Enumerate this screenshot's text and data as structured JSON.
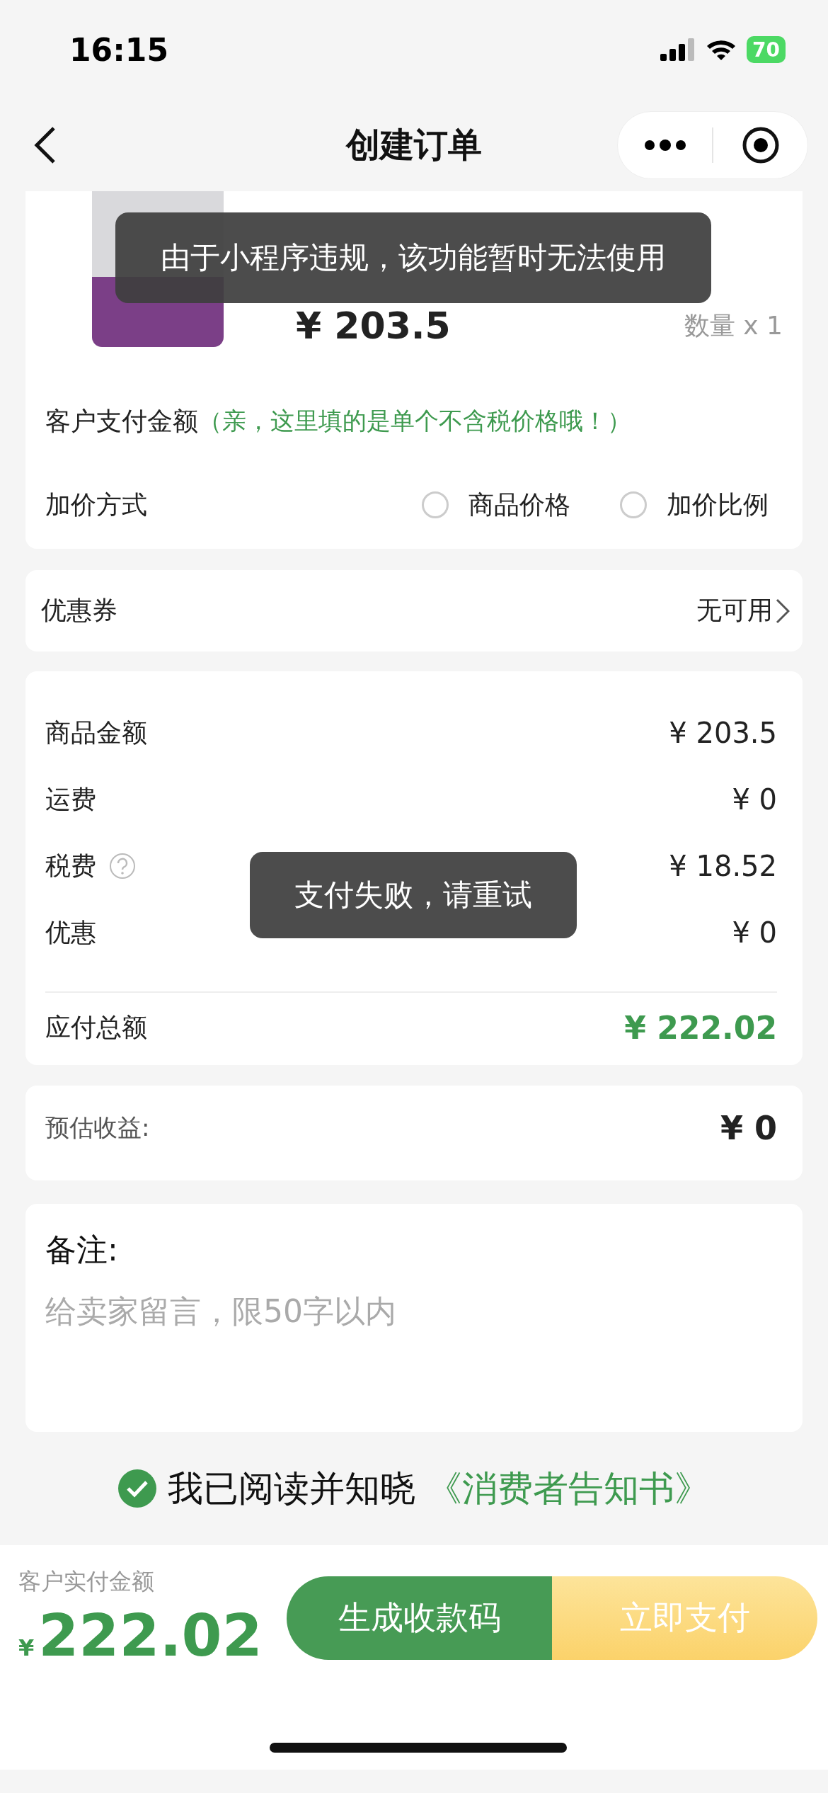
{
  "status_bar": {
    "time": "16:15",
    "battery": "70"
  },
  "nav": {
    "title": "创建订单"
  },
  "product": {
    "price": "¥ 203.5",
    "quantity": "数量 x 1"
  },
  "pay_amount": {
    "label": "客户支付金额",
    "hint": "（亲，这里填的是单个不含税价格哦！）"
  },
  "markup": {
    "label": "加价方式",
    "options": [
      {
        "label": "商品价格",
        "selected": false
      },
      {
        "label": "加价比例",
        "selected": false
      }
    ]
  },
  "coupon": {
    "label": "优惠券",
    "value": "无可用"
  },
  "summary": {
    "rows": [
      {
        "label": "商品金额",
        "value": "¥ 203.5",
        "help": false
      },
      {
        "label": "运费",
        "value": "¥ 0",
        "help": false
      },
      {
        "label": "税费",
        "value": "¥ 18.52",
        "help": true
      },
      {
        "label": "优惠",
        "value": "¥ 0",
        "help": false
      }
    ],
    "total": {
      "label": "应付总额",
      "value": "¥ 222.02"
    }
  },
  "earnings": {
    "label": "预估收益:",
    "value": "¥ 0"
  },
  "remark": {
    "label": "备注:",
    "placeholder": "给卖家留言，限50字以内"
  },
  "agreement": {
    "checked": true,
    "text": "我已阅读并知晓",
    "link": "《消费者告知书》"
  },
  "bottom_bar": {
    "label": "客户实付金额",
    "currency": "¥",
    "amount": "222.02",
    "buttons": [
      {
        "kind": "secondary",
        "label": "生成收款码"
      },
      {
        "kind": "primary",
        "label": "立即支付"
      }
    ]
  },
  "toasts": [
    "由于小程序违规，该功能暂时无法使用",
    "支付失败，请重试"
  ]
}
